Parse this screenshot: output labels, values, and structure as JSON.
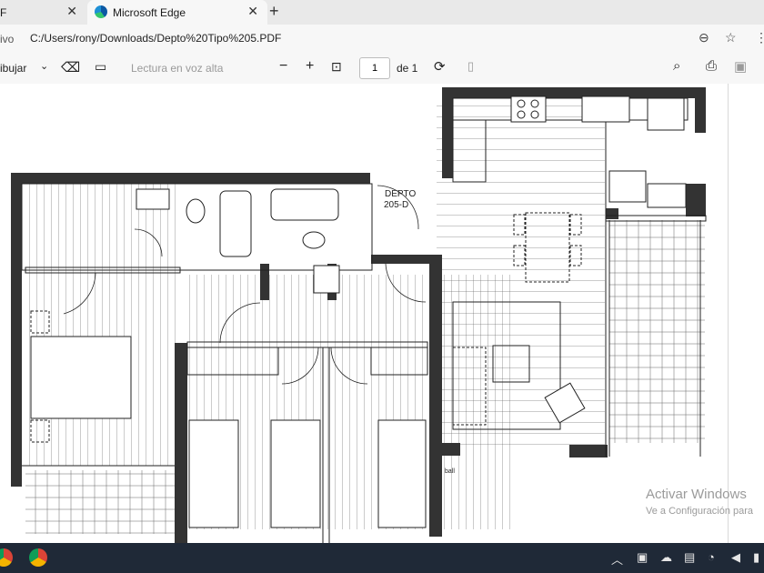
{
  "browser": {
    "tabs": [
      {
        "label": "F"
      },
      {
        "label": "Microsoft Edge"
      }
    ],
    "address_prefix": "ivo",
    "url": "C:/Users/rony/Downloads/Depto%20Tipo%205.PDF"
  },
  "pdf_toolbar": {
    "draw_label": "ibujar",
    "read_aloud_label": "Lectura en voz alta",
    "page_number": "1",
    "page_total": "de 1"
  },
  "plan": {
    "room_label_line1": "DEPTO",
    "room_label_line2": "205-D",
    "small_label": "ball"
  },
  "watermark": {
    "line1": "Activar Windows",
    "line2": "Ve a Configuración para"
  }
}
